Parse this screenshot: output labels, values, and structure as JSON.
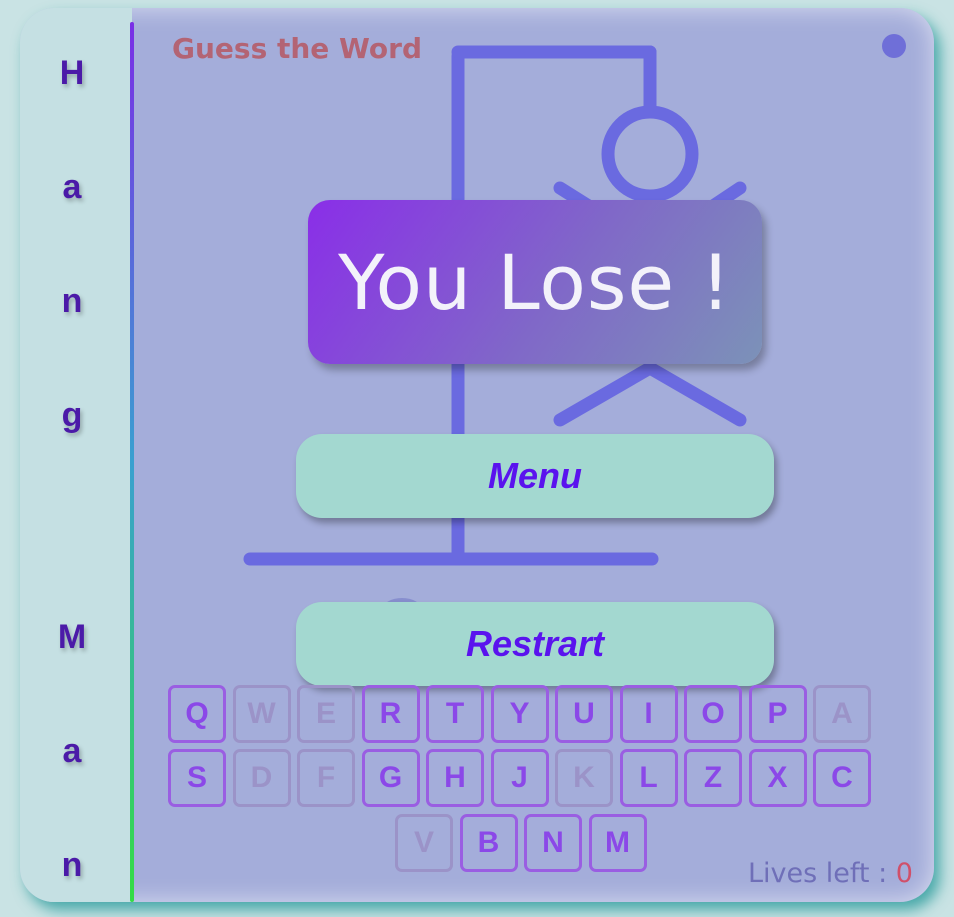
{
  "sidebar": {
    "letters": [
      "H",
      "a",
      "n",
      "g",
      "M",
      "a",
      "n"
    ]
  },
  "header": {
    "title": "Guess the Word"
  },
  "modal": {
    "message": "You Lose !",
    "menu_label": "Menu",
    "restart_label": "Restrart"
  },
  "keyboard": {
    "rows": [
      [
        {
          "letter": "Q",
          "used": false
        },
        {
          "letter": "W",
          "used": true
        },
        {
          "letter": "E",
          "used": true
        },
        {
          "letter": "R",
          "used": false
        },
        {
          "letter": "T",
          "used": false
        },
        {
          "letter": "Y",
          "used": false
        },
        {
          "letter": "U",
          "used": false
        },
        {
          "letter": "I",
          "used": false
        },
        {
          "letter": "O",
          "used": false
        },
        {
          "letter": "P",
          "used": false
        },
        {
          "letter": "A",
          "used": true
        }
      ],
      [
        {
          "letter": "S",
          "used": false
        },
        {
          "letter": "D",
          "used": true
        },
        {
          "letter": "F",
          "used": true
        },
        {
          "letter": "G",
          "used": false
        },
        {
          "letter": "H",
          "used": false
        },
        {
          "letter": "J",
          "used": false
        },
        {
          "letter": "K",
          "used": true
        },
        {
          "letter": "L",
          "used": false
        },
        {
          "letter": "Z",
          "used": false
        },
        {
          "letter": "X",
          "used": false
        },
        {
          "letter": "C",
          "used": false
        }
      ],
      [
        {
          "letter": "V",
          "used": true
        },
        {
          "letter": "B",
          "used": false
        },
        {
          "letter": "N",
          "used": false
        },
        {
          "letter": "M",
          "used": false
        }
      ]
    ]
  },
  "status": {
    "lives_label": "Lives left :",
    "lives_value": "0"
  },
  "colors": {
    "accent": "#6a6ae0",
    "button_text": "#5a13ee",
    "key_active": "#8b48e8",
    "key_used": "#9b93c8",
    "lives_value": "#d0506a"
  }
}
